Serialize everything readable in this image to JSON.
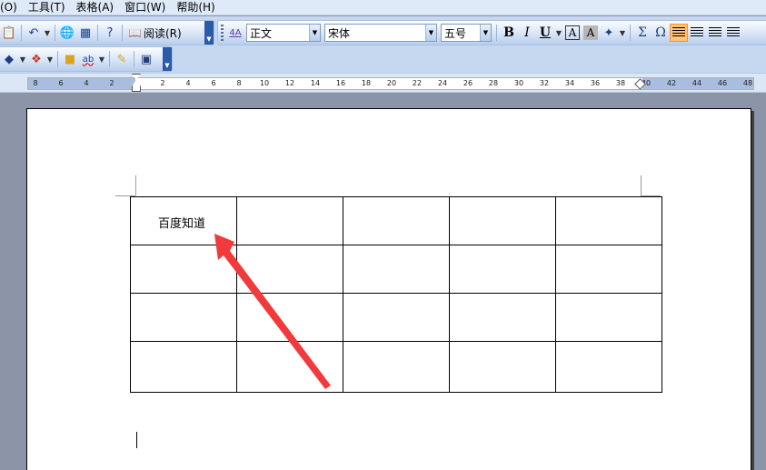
{
  "menu": {
    "items": [
      "(O)",
      "工具(T)",
      "表格(A)",
      "窗口(W)",
      "帮助(H)"
    ]
  },
  "toolbar": {
    "read_label": "阅读(R)",
    "style_value": "正文",
    "font_value": "宋体",
    "size_value": "五号",
    "bold_label": "B",
    "italic_label": "I",
    "underline_label": "U",
    "char_border_label": "A",
    "char_shade_label": "A",
    "sum_label": "Σ",
    "omega_label": "Ω",
    "style_icon_label": "4A",
    "spell_icon_label": "ab"
  },
  "ruler": {
    "ticks": [
      "8",
      "6",
      "4",
      "2",
      "2",
      "4",
      "6",
      "8",
      "10",
      "12",
      "14",
      "16",
      "18",
      "20",
      "22",
      "24",
      "26",
      "28",
      "30",
      "32",
      "34",
      "36",
      "38",
      "40",
      "42",
      "44",
      "46",
      "48"
    ]
  },
  "document": {
    "table": {
      "rows": [
        [
          "百度知道",
          "",
          "",
          "",
          ""
        ],
        [
          "",
          "",
          "",
          "",
          ""
        ],
        [
          "",
          "",
          "",
          "",
          ""
        ],
        [
          "",
          "",
          "",
          "",
          ""
        ]
      ]
    }
  },
  "colors": {
    "annotation_arrow": "#f2393c",
    "workspace_bg": "#8c94a8",
    "active_button": "#ffc478"
  }
}
